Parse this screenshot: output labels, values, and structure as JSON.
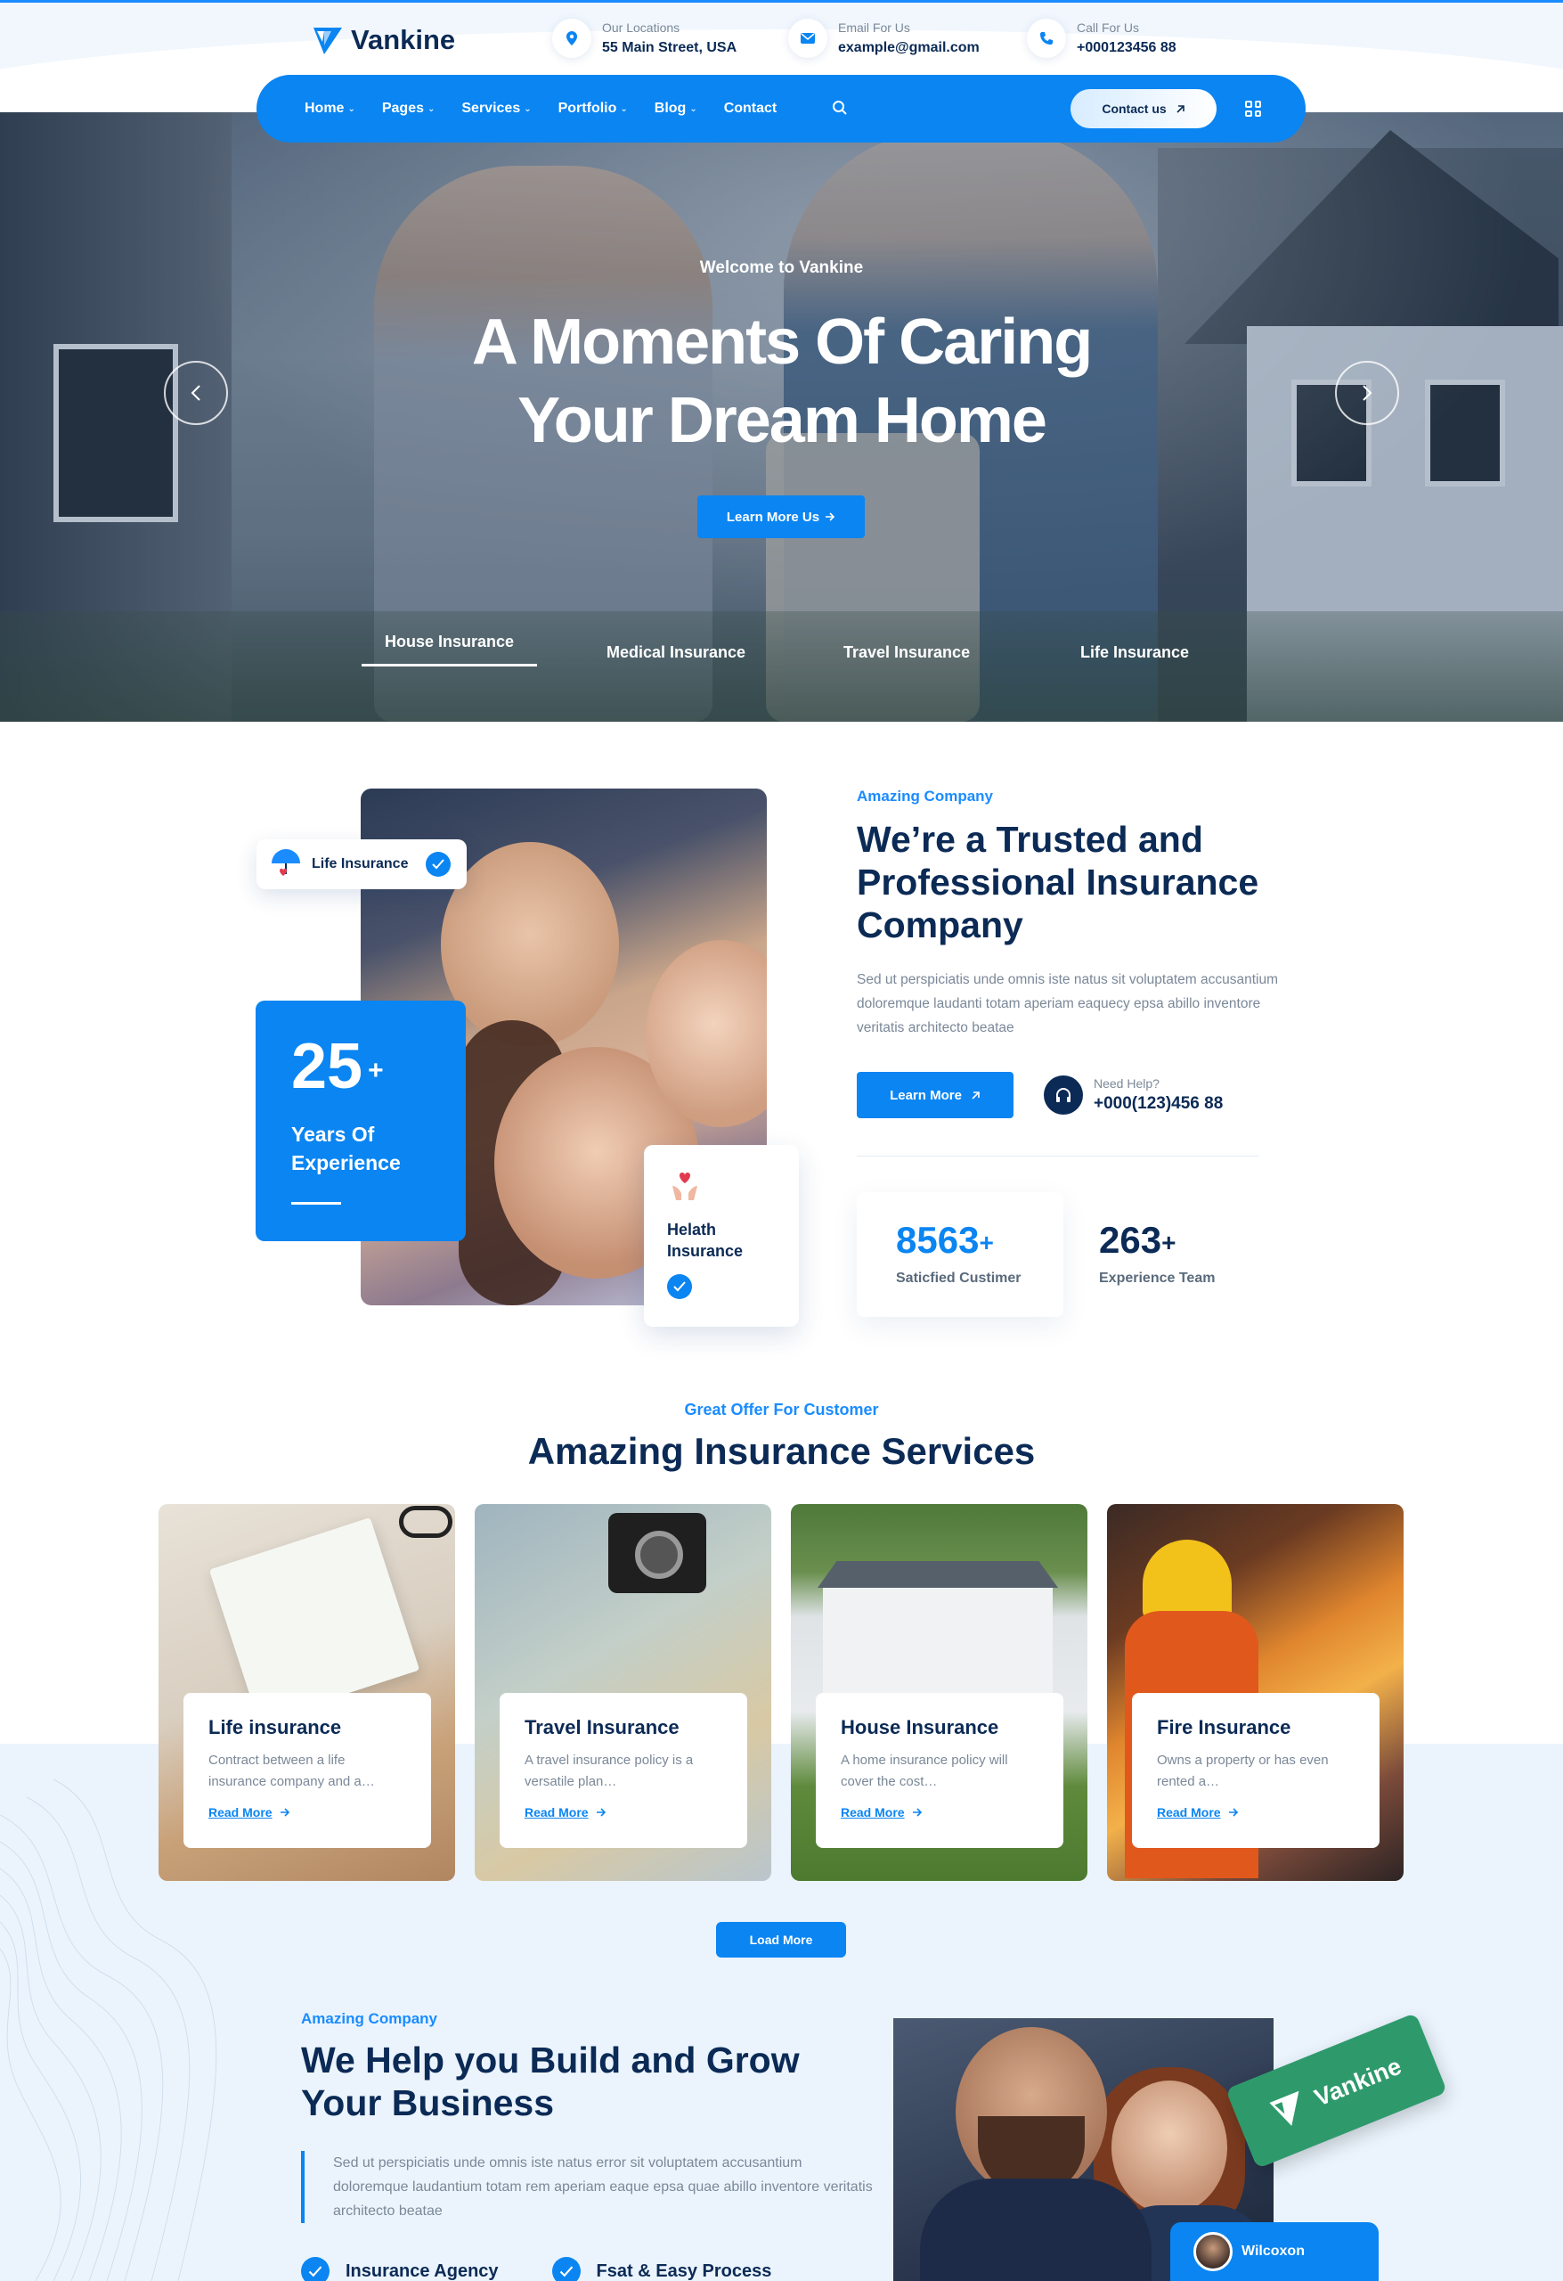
{
  "header": {
    "logo": "Vankine",
    "locations_label": "Our Locations",
    "locations_value": "55 Main Street, USA",
    "email_label": "Email For Us",
    "email_value": "example@gmail.com",
    "call_label": "Call For Us",
    "call_value": "+000123456 88"
  },
  "nav": {
    "items": [
      "Home",
      "Pages",
      "Services",
      "Portfolio",
      "Blog",
      "Contact"
    ],
    "contact_button": "Contact us"
  },
  "hero": {
    "kicker": "Welcome to Vankine",
    "title_line1": "A Moments Of Caring",
    "title_line2": "Your Dream Home",
    "button": "Learn More Us",
    "tabs": [
      "House Insurance",
      "Medical Insurance",
      "Travel Insurance",
      "Life Insurance"
    ]
  },
  "about": {
    "badge_life": "Life Insurance",
    "years_num": "25",
    "years_plus": "+",
    "years_text_1": "Years Of",
    "years_text_2": "Experience",
    "health_1": "Helath",
    "health_2": "Insurance",
    "eyebrow": "Amazing Company",
    "title": "We’re a Trusted and Professional Insurance Company",
    "desc": "Sed ut perspiciatis unde omnis iste natus sit voluptatem accusantium doloremque laudanti totam aperiam eaquecy epsa abillo inventore veritatis architecto beatae",
    "button": "Learn More",
    "help_label": "Need Help?",
    "help_phone": "+000(123)456 88",
    "stat1_num": "8563",
    "stat1_plus": "+",
    "stat1_label": "Saticfied Custimer",
    "stat2_num": "263",
    "stat2_plus": "+",
    "stat2_label": "Experience Team"
  },
  "services": {
    "eyebrow": "Great Offer For Customer",
    "title": "Amazing Insurance Services",
    "cards": [
      {
        "title": "Life insurance",
        "desc": "Contract between a life insurance company and a…",
        "link": "Read More"
      },
      {
        "title": "Travel Insurance",
        "desc": "A travel insurance policy is a versatile plan…",
        "link": "Read More"
      },
      {
        "title": "House Insurance",
        "desc": "A home insurance policy will cover the cost…",
        "link": "Read More"
      },
      {
        "title": "Fire Insurance",
        "desc": "Owns a property or has even rented a…",
        "link": "Read More"
      }
    ],
    "load_more": "Load More"
  },
  "grow": {
    "eyebrow": "Amazing Company",
    "title_1": "We Help you Build and Grow",
    "title_2": "Your Business",
    "desc": "Sed ut perspiciatis unde omnis iste natus error sit voluptatem accusantium doloremque laudantium totam rem aperiam eaque epsa quae abillo inventore veritatis architecto beatae",
    "feature_1": "Insurance Agency",
    "feature_2": "Fsat & Easy Process",
    "tag": "Vankine",
    "person": "Wilcoxon"
  },
  "colors": {
    "primary": "#0a85f2",
    "dark": "#0b2a55",
    "muted": "#7b8898"
  }
}
